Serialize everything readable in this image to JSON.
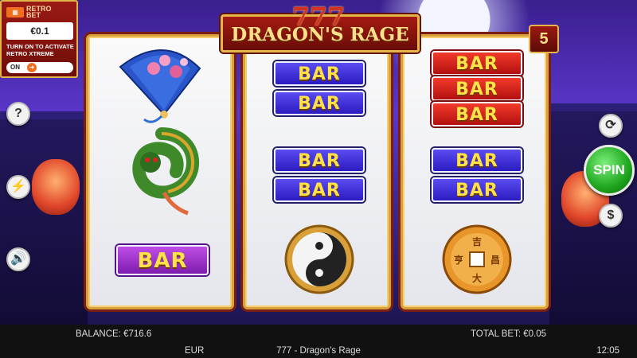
{
  "game": {
    "title_number": "777",
    "title": "DRAGON'S RAGE",
    "lines": "5",
    "spin_label": "SPIN"
  },
  "retro_bet": {
    "logo": "RETRO BET",
    "bet_value": "€0.1",
    "hint": "TURN ON TO ACTIVATE RETRO XTREME",
    "toggle_label": "ON"
  },
  "reels": [
    {
      "symbols": [
        "fan",
        "dragon",
        "BAR"
      ]
    },
    {
      "symbols": [
        "BAR",
        "BAR",
        "BAR",
        "BAR",
        "yin-yang"
      ]
    },
    {
      "symbols": [
        "BAR",
        "BAR",
        "BAR",
        "BAR",
        "BAR",
        "coin"
      ]
    }
  ],
  "bar_label": "BAR",
  "coin_glyphs": [
    "吉",
    "大",
    "亨",
    "昌"
  ],
  "buttons": {
    "help": "?",
    "turbo": "⚡",
    "sound": "🔊",
    "refresh": "⟳",
    "coin": "$"
  },
  "status": {
    "balance": "BALANCE: €716.6",
    "total_bet": "TOTAL BET: €0.05",
    "currency": "EUR",
    "game_name": "777 - Dragon's Rage",
    "time": "12:05"
  }
}
